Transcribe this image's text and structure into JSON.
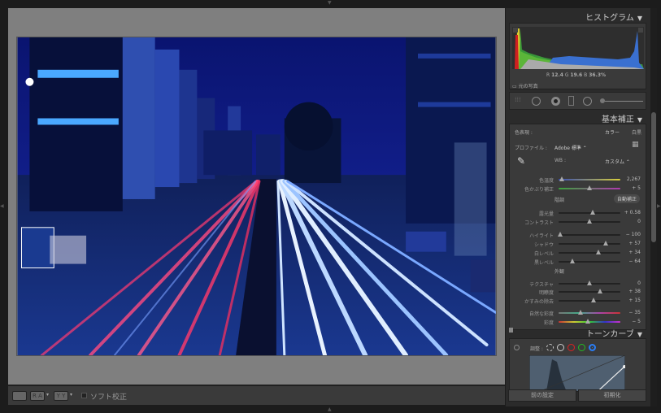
{
  "histogram": {
    "title": "ヒストグラム",
    "readout": {
      "r_label": "R",
      "r": "12.4",
      "g_label": "G",
      "g": "19.6",
      "b_label": "B",
      "b": "36.3%"
    },
    "original_photo": "元の写真"
  },
  "basic": {
    "title": "基本補正",
    "treatment_label": "色表現 :",
    "color": "カラー",
    "bw": "白黒",
    "profile_label": "プロファイル :",
    "profile_value": "Adobe 標準",
    "wb_label": "WB :",
    "wb_value": "カスタム",
    "tone_label": "階調",
    "auto": "自動補正",
    "presence_label": "外観",
    "sliders": [
      {
        "name": "temp",
        "label": "色温度",
        "value": "2,267",
        "level": 0.05,
        "gradient": "linear-gradient(90deg,#3a4fb5,#d8cf3a)"
      },
      {
        "name": "tint",
        "label": "色かぶり補正",
        "value": "+ 5",
        "level": 0.5,
        "gradient": "linear-gradient(90deg,#3aa53a,#b03ab0)"
      },
      {
        "name": "exposure",
        "label": "露光量",
        "value": "+ 0.58",
        "level": 0.55
      },
      {
        "name": "contrast",
        "label": "コントラスト",
        "value": "0",
        "level": 0.5
      },
      {
        "name": "highlights",
        "label": "ハイライト",
        "value": "− 100",
        "level": 0.03
      },
      {
        "name": "shadows",
        "label": "シャドウ",
        "value": "+ 57",
        "level": 0.76
      },
      {
        "name": "whites",
        "label": "白レベル",
        "value": "+ 34",
        "level": 0.65
      },
      {
        "name": "blacks",
        "label": "黒レベル",
        "value": "− 64",
        "level": 0.22
      },
      {
        "name": "texture",
        "label": "テクスチャ",
        "value": "0",
        "level": 0.5
      },
      {
        "name": "clarity",
        "label": "明瞭度",
        "value": "+ 38",
        "level": 0.67
      },
      {
        "name": "dehaze",
        "label": "かすみの除去",
        "value": "+ 15",
        "level": 0.57
      },
      {
        "name": "vibrance",
        "label": "自然な彩度",
        "value": "− 35",
        "level": 0.35,
        "gradient": "linear-gradient(90deg,#777,#4a8,#a4a,#c33)"
      },
      {
        "name": "saturation",
        "label": "彩度",
        "value": "− 5",
        "level": 0.48,
        "gradient": "linear-gradient(90deg,#c33,#cc3,#3c3,#33c,#c3c)"
      }
    ]
  },
  "tone_curve": {
    "title": "トーンカーブ",
    "adjust_label": "調整 :",
    "channels": [
      "point",
      "rgb",
      "red",
      "green",
      "blue"
    ],
    "channel_colors": [
      "#ccc",
      "#ccc",
      "#d22",
      "#2b2",
      "#2a7df5"
    ],
    "selected": "blue"
  },
  "buttons": {
    "previous": "前の設定",
    "reset": "初期化"
  },
  "toolbar": {
    "soft_proof": "ソフト校正",
    "compare_ra": "R A",
    "compare_yy": "Y Y"
  },
  "accent": "#2a7df5"
}
